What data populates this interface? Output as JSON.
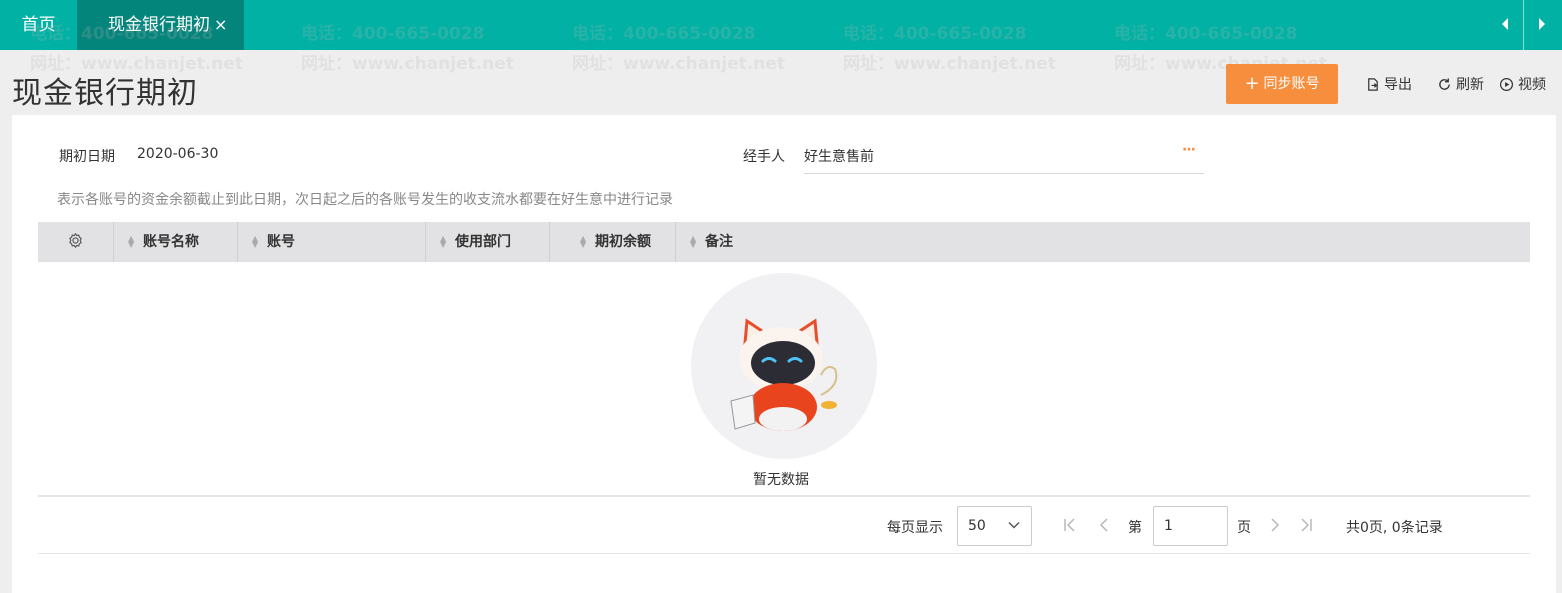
{
  "tabs": {
    "home": "首页",
    "active": "现金银行期初",
    "close": "×"
  },
  "header": {
    "title": "现金银行期初",
    "sync_button": "同步账号",
    "export": "导出",
    "refresh": "刷新",
    "video": "视频"
  },
  "form": {
    "date_label": "期初日期",
    "date_value": "2020-06-30",
    "handler_label": "经手人",
    "handler_value": "好生意售前",
    "more": "···",
    "hint": "表示各账号的资金余额截止到此日期，次日起之后的各账号发生的收支流水都要在好生意中进行记录"
  },
  "table": {
    "columns": [
      "账号名称",
      "账号",
      "使用部门",
      "期初余额",
      "备注"
    ],
    "empty_text": "暂无数据"
  },
  "pagination": {
    "per_page_label": "每页显示",
    "per_page_value": "50",
    "page_prefix": "第",
    "page_value": "1",
    "page_suffix": "页",
    "total": "共0页, 0条记录"
  },
  "watermark": {
    "phone": "电话：400-665-0028",
    "site": "网址：www.chanjet.net"
  },
  "colors": {
    "teal": "#00b1a4",
    "teal_dark": "#04857c",
    "orange": "#f78e3d"
  }
}
